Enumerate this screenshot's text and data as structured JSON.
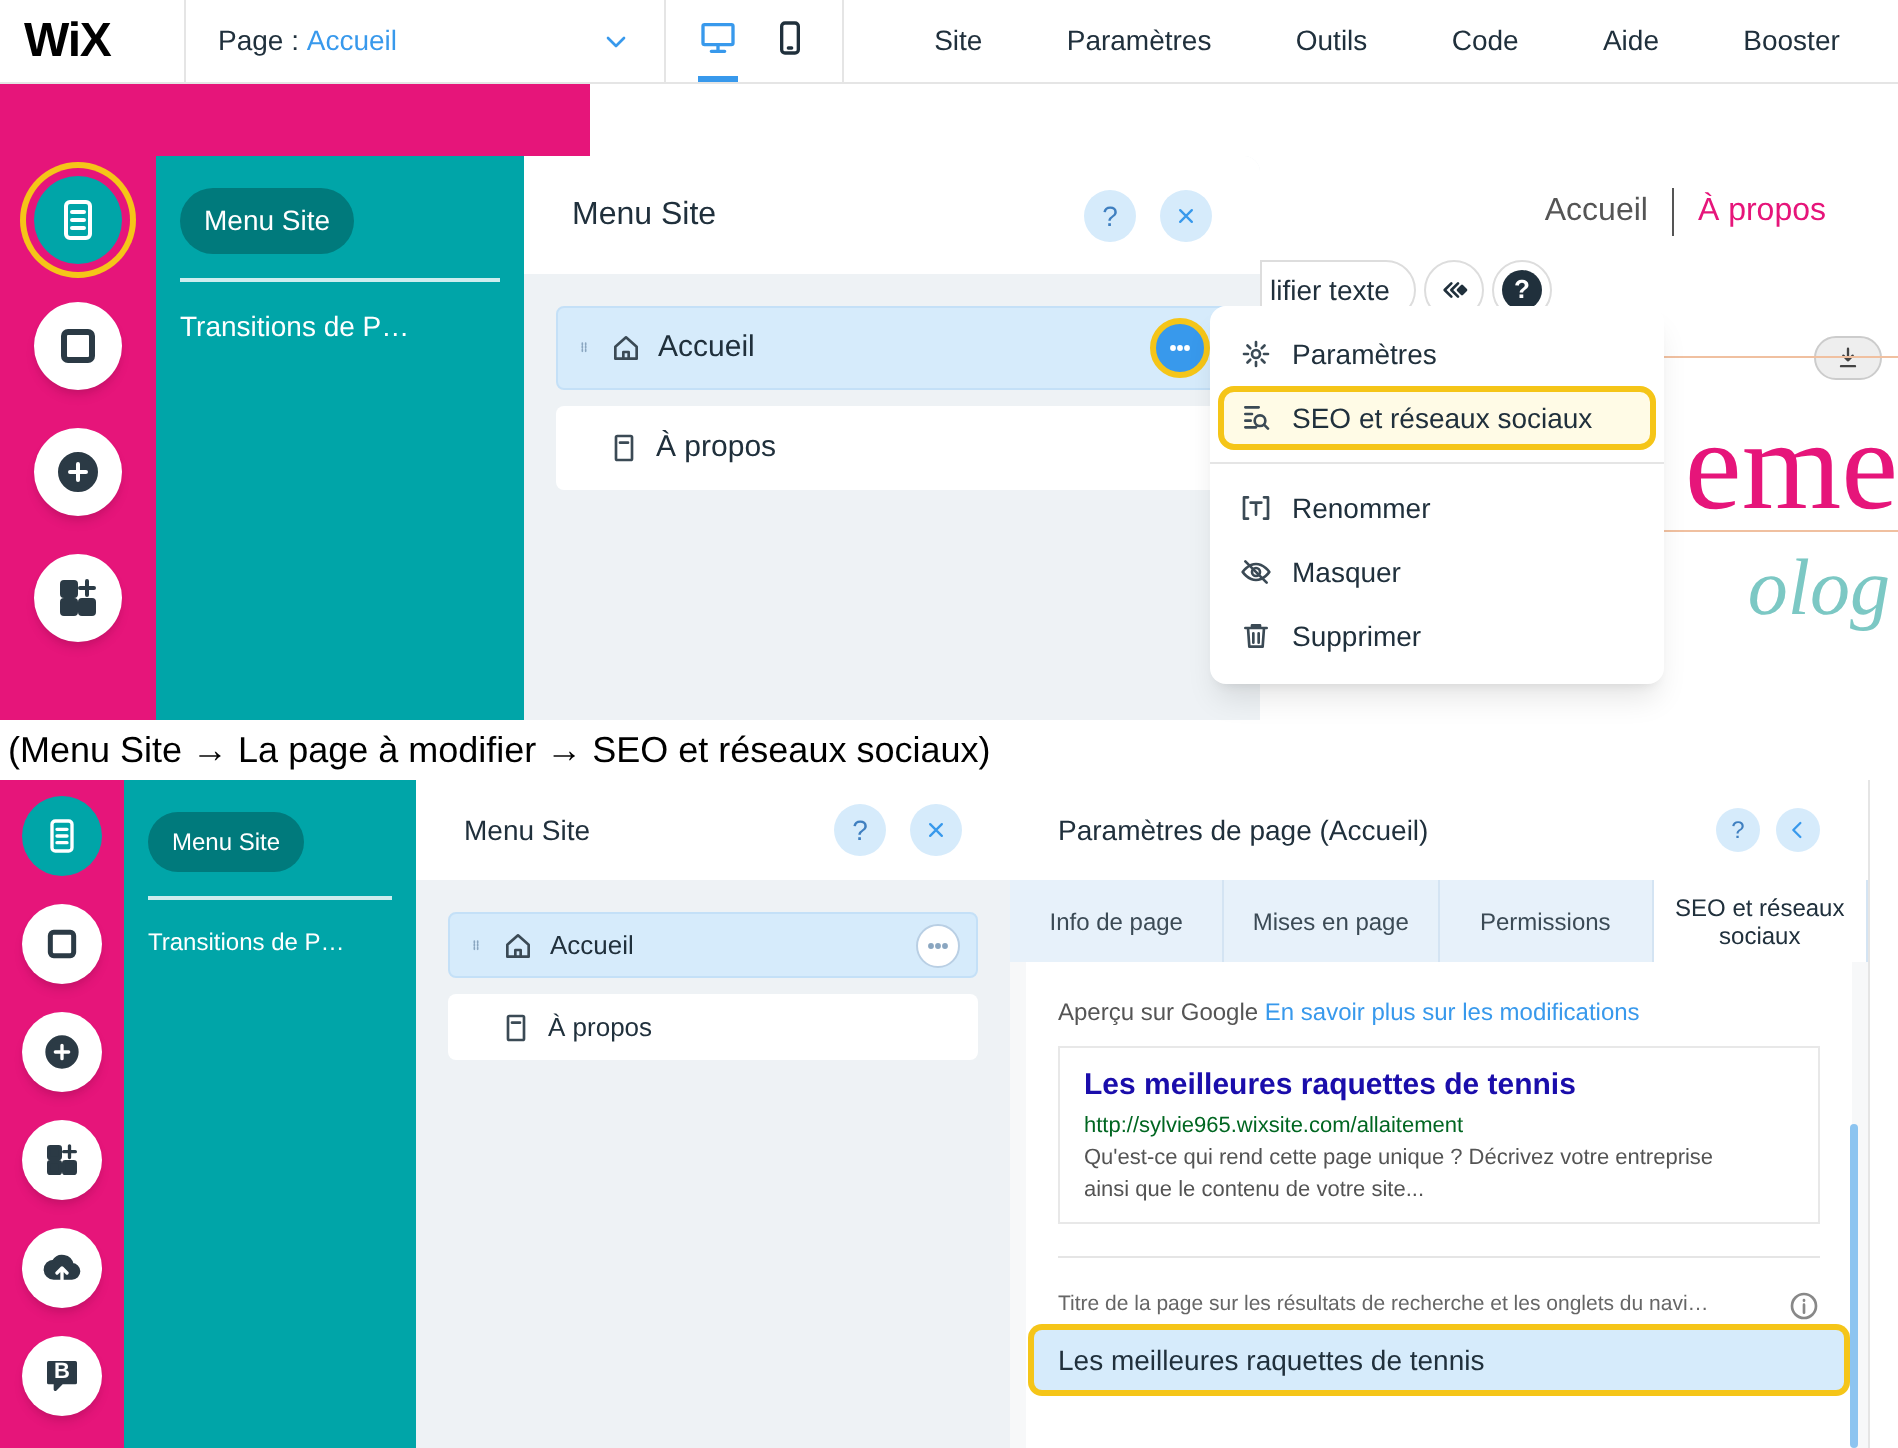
{
  "top": {
    "header": {
      "logo": "WiX",
      "page_label": "Page :",
      "page_value": "Accueil",
      "devices": [
        {
          "kind": "desktop",
          "selected": true
        },
        {
          "kind": "mobile",
          "selected": false
        }
      ],
      "nav": [
        "Site",
        "Paramètres",
        "Outils",
        "Code",
        "Aide",
        "Booster"
      ]
    },
    "sidebar": [
      {
        "kind": "pages",
        "selected": true,
        "highlighted": true
      },
      {
        "kind": "background",
        "selected": false,
        "highlighted": false
      },
      {
        "kind": "add",
        "selected": false,
        "highlighted": false
      },
      {
        "kind": "apps",
        "selected": false,
        "highlighted": false
      }
    ],
    "side_menu": [
      {
        "label": "Menu Site",
        "selected": true
      },
      {
        "label": "Transitions de P…",
        "selected": false
      }
    ],
    "panel": {
      "title": "Menu Site",
      "help": "?",
      "pages": [
        {
          "label": "Accueil",
          "kind": "home",
          "selected": true,
          "more_button": {
            "active": true,
            "highlighted": true
          }
        },
        {
          "label": "À propos",
          "kind": "page",
          "selected": false
        }
      ]
    },
    "context_menu": [
      [
        {
          "label": "Paramètres",
          "kind": "gear",
          "highlighted": false
        },
        {
          "label": "SEO et réseaux sociaux",
          "kind": "seo",
          "highlighted": true
        }
      ],
      [
        {
          "label": "Renommer",
          "kind": "rename",
          "highlighted": false
        },
        {
          "label": "Masquer",
          "kind": "hide",
          "highlighted": false
        },
        {
          "label": "Supprimer",
          "kind": "trash",
          "highlighted": false
        }
      ]
    ],
    "canvas": {
      "nav": [
        {
          "label": "Accueil",
          "selected": false
        },
        {
          "label": "À propos",
          "selected": true
        }
      ],
      "toolbar_text": "lifier texte",
      "help": "?",
      "heading_fragment": "eme",
      "script_fragment": "olog"
    }
  },
  "caption": "(Menu Site → La page à modifier → SEO et réseaux sociaux)",
  "bottom": {
    "sidebar": [
      {
        "kind": "pages",
        "selected": true
      },
      {
        "kind": "background",
        "selected": false
      },
      {
        "kind": "add",
        "selected": false
      },
      {
        "kind": "apps",
        "selected": false
      },
      {
        "kind": "upload",
        "selected": false
      },
      {
        "kind": "blog",
        "selected": false,
        "text": "B"
      }
    ],
    "side_menu": [
      {
        "label": "Menu Site",
        "selected": true
      },
      {
        "label": "Transitions de P…",
        "selected": false
      }
    ],
    "panel": {
      "title": "Menu Site",
      "help": "?",
      "pages": [
        {
          "label": "Accueil",
          "kind": "home",
          "selected": true,
          "more_button": {
            "active": false,
            "highlighted": false
          }
        },
        {
          "label": "À propos",
          "kind": "page",
          "selected": false
        }
      ]
    },
    "settings": {
      "title": "Paramètres de page (Accueil)",
      "help": "?",
      "tabs": [
        {
          "label": "Info de page",
          "selected": false
        },
        {
          "label": "Mises en page",
          "selected": false
        },
        {
          "label": "Permissions",
          "selected": false
        },
        {
          "label": "SEO et réseaux sociaux",
          "selected": true
        }
      ],
      "preview_label": "Aperçu sur Google",
      "preview_link": "En savoir plus sur les modifications",
      "result": {
        "title": "Les meilleures raquettes de tennis",
        "url": "http://sylvie965.wixsite.com/allaitement",
        "description": "Qu'est-ce qui rend cette page unique ? Décrivez votre entreprise ainsi que le contenu de votre site..."
      },
      "field_label": "Titre de la page sur les résultats de recherche et les onglets du navi…",
      "field_value": "Les meilleures raquettes de tennis",
      "field_highlighted": true
    }
  }
}
